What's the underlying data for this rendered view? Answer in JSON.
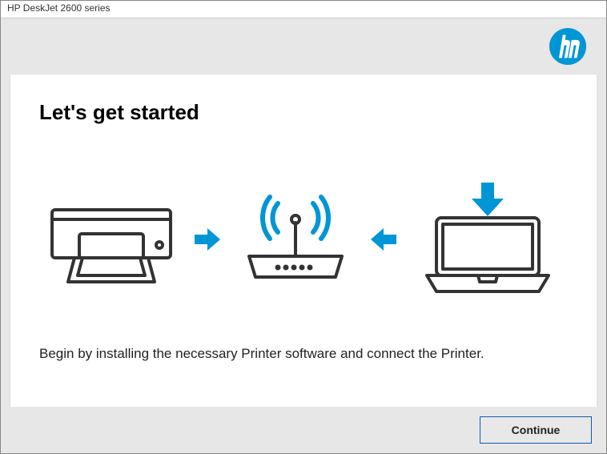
{
  "window": {
    "title": "HP DeskJet 2600 series"
  },
  "card": {
    "heading": "Let's get started",
    "instruction": "Begin by installing the necessary Printer software and connect the Printer."
  },
  "footer": {
    "continue_label": "Continue"
  },
  "brand": {
    "logo_color": "#0096d6",
    "arrow_color": "#0096d6",
    "line_color": "#333333"
  }
}
